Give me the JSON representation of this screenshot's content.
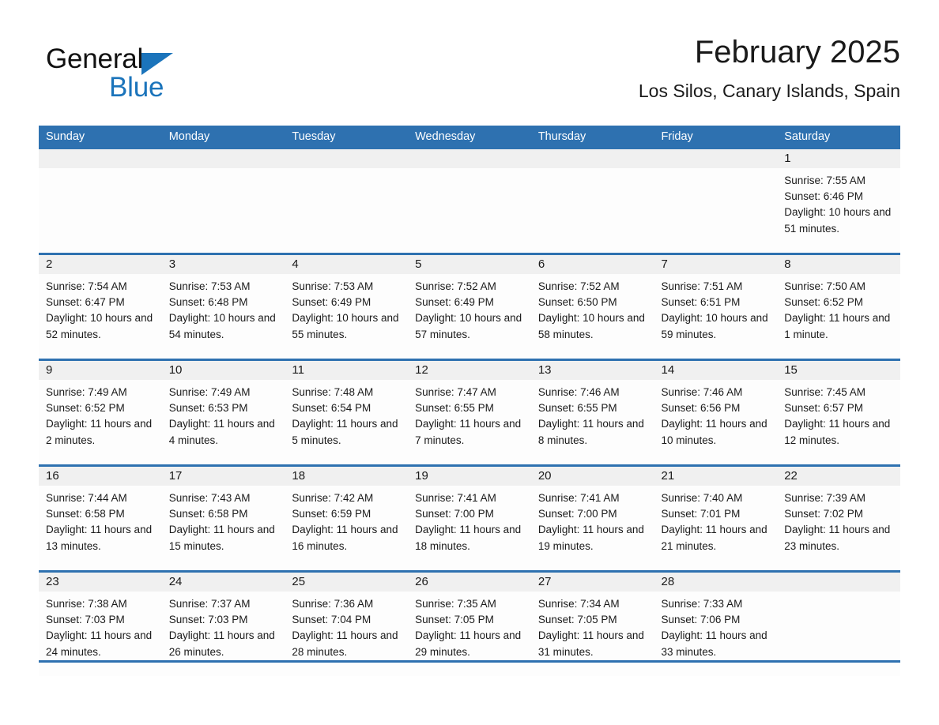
{
  "brand": {
    "name_part1": "General",
    "name_part2": "Blue",
    "triangle_color": "#1b74bb"
  },
  "header": {
    "title": "February 2025",
    "subtitle": "Los Silos, Canary Islands, Spain"
  },
  "theme": {
    "header_blue": "#2e71b0",
    "daynum_band": "#f0f0f0",
    "text": "#1a1a1a"
  },
  "weekday_headers": [
    "Sunday",
    "Monday",
    "Tuesday",
    "Wednesday",
    "Thursday",
    "Friday",
    "Saturday"
  ],
  "weeks": [
    [
      {
        "day": "",
        "sunrise": "",
        "sunset": "",
        "daylight": ""
      },
      {
        "day": "",
        "sunrise": "",
        "sunset": "",
        "daylight": ""
      },
      {
        "day": "",
        "sunrise": "",
        "sunset": "",
        "daylight": ""
      },
      {
        "day": "",
        "sunrise": "",
        "sunset": "",
        "daylight": ""
      },
      {
        "day": "",
        "sunrise": "",
        "sunset": "",
        "daylight": ""
      },
      {
        "day": "",
        "sunrise": "",
        "sunset": "",
        "daylight": ""
      },
      {
        "day": "1",
        "sunrise": "Sunrise: 7:55 AM",
        "sunset": "Sunset: 6:46 PM",
        "daylight": "Daylight: 10 hours and 51 minutes."
      }
    ],
    [
      {
        "day": "2",
        "sunrise": "Sunrise: 7:54 AM",
        "sunset": "Sunset: 6:47 PM",
        "daylight": "Daylight: 10 hours and 52 minutes."
      },
      {
        "day": "3",
        "sunrise": "Sunrise: 7:53 AM",
        "sunset": "Sunset: 6:48 PM",
        "daylight": "Daylight: 10 hours and 54 minutes."
      },
      {
        "day": "4",
        "sunrise": "Sunrise: 7:53 AM",
        "sunset": "Sunset: 6:49 PM",
        "daylight": "Daylight: 10 hours and 55 minutes."
      },
      {
        "day": "5",
        "sunrise": "Sunrise: 7:52 AM",
        "sunset": "Sunset: 6:49 PM",
        "daylight": "Daylight: 10 hours and 57 minutes."
      },
      {
        "day": "6",
        "sunrise": "Sunrise: 7:52 AM",
        "sunset": "Sunset: 6:50 PM",
        "daylight": "Daylight: 10 hours and 58 minutes."
      },
      {
        "day": "7",
        "sunrise": "Sunrise: 7:51 AM",
        "sunset": "Sunset: 6:51 PM",
        "daylight": "Daylight: 10 hours and 59 minutes."
      },
      {
        "day": "8",
        "sunrise": "Sunrise: 7:50 AM",
        "sunset": "Sunset: 6:52 PM",
        "daylight": "Daylight: 11 hours and 1 minute."
      }
    ],
    [
      {
        "day": "9",
        "sunrise": "Sunrise: 7:49 AM",
        "sunset": "Sunset: 6:52 PM",
        "daylight": "Daylight: 11 hours and 2 minutes."
      },
      {
        "day": "10",
        "sunrise": "Sunrise: 7:49 AM",
        "sunset": "Sunset: 6:53 PM",
        "daylight": "Daylight: 11 hours and 4 minutes."
      },
      {
        "day": "11",
        "sunrise": "Sunrise: 7:48 AM",
        "sunset": "Sunset: 6:54 PM",
        "daylight": "Daylight: 11 hours and 5 minutes."
      },
      {
        "day": "12",
        "sunrise": "Sunrise: 7:47 AM",
        "sunset": "Sunset: 6:55 PM",
        "daylight": "Daylight: 11 hours and 7 minutes."
      },
      {
        "day": "13",
        "sunrise": "Sunrise: 7:46 AM",
        "sunset": "Sunset: 6:55 PM",
        "daylight": "Daylight: 11 hours and 8 minutes."
      },
      {
        "day": "14",
        "sunrise": "Sunrise: 7:46 AM",
        "sunset": "Sunset: 6:56 PM",
        "daylight": "Daylight: 11 hours and 10 minutes."
      },
      {
        "day": "15",
        "sunrise": "Sunrise: 7:45 AM",
        "sunset": "Sunset: 6:57 PM",
        "daylight": "Daylight: 11 hours and 12 minutes."
      }
    ],
    [
      {
        "day": "16",
        "sunrise": "Sunrise: 7:44 AM",
        "sunset": "Sunset: 6:58 PM",
        "daylight": "Daylight: 11 hours and 13 minutes."
      },
      {
        "day": "17",
        "sunrise": "Sunrise: 7:43 AM",
        "sunset": "Sunset: 6:58 PM",
        "daylight": "Daylight: 11 hours and 15 minutes."
      },
      {
        "day": "18",
        "sunrise": "Sunrise: 7:42 AM",
        "sunset": "Sunset: 6:59 PM",
        "daylight": "Daylight: 11 hours and 16 minutes."
      },
      {
        "day": "19",
        "sunrise": "Sunrise: 7:41 AM",
        "sunset": "Sunset: 7:00 PM",
        "daylight": "Daylight: 11 hours and 18 minutes."
      },
      {
        "day": "20",
        "sunrise": "Sunrise: 7:41 AM",
        "sunset": "Sunset: 7:00 PM",
        "daylight": "Daylight: 11 hours and 19 minutes."
      },
      {
        "day": "21",
        "sunrise": "Sunrise: 7:40 AM",
        "sunset": "Sunset: 7:01 PM",
        "daylight": "Daylight: 11 hours and 21 minutes."
      },
      {
        "day": "22",
        "sunrise": "Sunrise: 7:39 AM",
        "sunset": "Sunset: 7:02 PM",
        "daylight": "Daylight: 11 hours and 23 minutes."
      }
    ],
    [
      {
        "day": "23",
        "sunrise": "Sunrise: 7:38 AM",
        "sunset": "Sunset: 7:03 PM",
        "daylight": "Daylight: 11 hours and 24 minutes."
      },
      {
        "day": "24",
        "sunrise": "Sunrise: 7:37 AM",
        "sunset": "Sunset: 7:03 PM",
        "daylight": "Daylight: 11 hours and 26 minutes."
      },
      {
        "day": "25",
        "sunrise": "Sunrise: 7:36 AM",
        "sunset": "Sunset: 7:04 PM",
        "daylight": "Daylight: 11 hours and 28 minutes."
      },
      {
        "day": "26",
        "sunrise": "Sunrise: 7:35 AM",
        "sunset": "Sunset: 7:05 PM",
        "daylight": "Daylight: 11 hours and 29 minutes."
      },
      {
        "day": "27",
        "sunrise": "Sunrise: 7:34 AM",
        "sunset": "Sunset: 7:05 PM",
        "daylight": "Daylight: 11 hours and 31 minutes."
      },
      {
        "day": "28",
        "sunrise": "Sunrise: 7:33 AM",
        "sunset": "Sunset: 7:06 PM",
        "daylight": "Daylight: 11 hours and 33 minutes."
      },
      {
        "day": "",
        "sunrise": "",
        "sunset": "",
        "daylight": ""
      }
    ]
  ]
}
